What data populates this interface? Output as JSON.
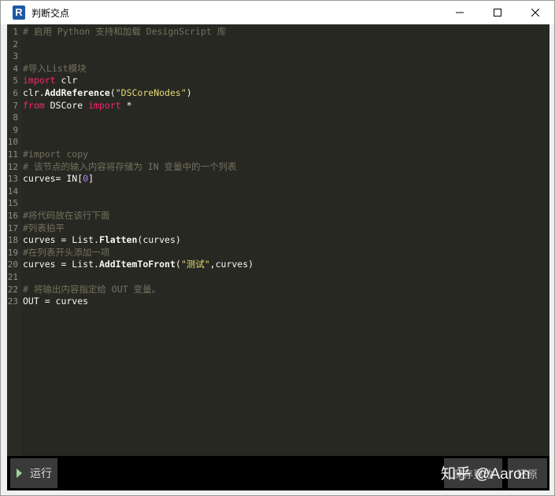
{
  "window": {
    "title": "判断交点",
    "icon_letter": "R",
    "controls": [
      "minimize-icon",
      "maximize-icon",
      "close-icon"
    ]
  },
  "editor": {
    "lines": [
      {
        "n": "1",
        "tokens": [
          {
            "t": "# 启用 Python 支持和加载 DesignScript 库",
            "c": "comment"
          }
        ]
      },
      {
        "n": "2",
        "tokens": []
      },
      {
        "n": "3",
        "tokens": []
      },
      {
        "n": "4",
        "tokens": [
          {
            "t": "#导入List模块",
            "c": "comment"
          }
        ]
      },
      {
        "n": "5",
        "tokens": [
          {
            "t": "import",
            "c": "kw"
          },
          {
            "t": " clr",
            "c": "plain"
          }
        ]
      },
      {
        "n": "6",
        "tokens": [
          {
            "t": "clr.",
            "c": "plain"
          },
          {
            "t": "AddReference",
            "c": "bold"
          },
          {
            "t": "(",
            "c": "plain"
          },
          {
            "t": "\"DSCoreNodes\"",
            "c": "str"
          },
          {
            "t": ")",
            "c": "plain"
          }
        ]
      },
      {
        "n": "7",
        "tokens": [
          {
            "t": "from",
            "c": "kw"
          },
          {
            "t": " DSCore ",
            "c": "plain"
          },
          {
            "t": "import",
            "c": "kw"
          },
          {
            "t": " *",
            "c": "plain"
          }
        ]
      },
      {
        "n": "8",
        "tokens": []
      },
      {
        "n": "9",
        "tokens": []
      },
      {
        "n": "10",
        "tokens": []
      },
      {
        "n": "11",
        "tokens": [
          {
            "t": "#import copy",
            "c": "comment"
          }
        ]
      },
      {
        "n": "12",
        "tokens": [
          {
            "t": "# 该节点的输入内容将存储为 IN 变量中的一个列表",
            "c": "comment"
          }
        ]
      },
      {
        "n": "13",
        "tokens": [
          {
            "t": "curves= IN[",
            "c": "plain"
          },
          {
            "t": "0",
            "c": "num"
          },
          {
            "t": "]",
            "c": "plain"
          }
        ]
      },
      {
        "n": "14",
        "tokens": []
      },
      {
        "n": "15",
        "tokens": []
      },
      {
        "n": "16",
        "tokens": [
          {
            "t": "#将代码放在该行下面",
            "c": "comment"
          }
        ]
      },
      {
        "n": "17",
        "tokens": [
          {
            "t": "#列表拍平",
            "c": "comment"
          }
        ]
      },
      {
        "n": "18",
        "tokens": [
          {
            "t": "curves = List.",
            "c": "plain"
          },
          {
            "t": "Flatten",
            "c": "bold"
          },
          {
            "t": "(curves)",
            "c": "plain"
          }
        ]
      },
      {
        "n": "19",
        "tokens": [
          {
            "t": "#在列表开头添加一项",
            "c": "comment"
          }
        ]
      },
      {
        "n": "20",
        "tokens": [
          {
            "t": "curves = List.",
            "c": "plain"
          },
          {
            "t": "AddItemToFront",
            "c": "bold"
          },
          {
            "t": "(",
            "c": "plain"
          },
          {
            "t": "\"测试\"",
            "c": "str"
          },
          {
            "t": ",curves)",
            "c": "plain"
          }
        ]
      },
      {
        "n": "21",
        "tokens": []
      },
      {
        "n": "22",
        "tokens": [
          {
            "t": "# 将输出内容指定给 OUT 变量。",
            "c": "comment"
          }
        ]
      },
      {
        "n": "23",
        "tokens": [
          {
            "t": "OUT = curves",
            "c": "plain"
          }
        ]
      }
    ]
  },
  "bottom": {
    "run_label": "运行",
    "save_label": "保存更改",
    "revert_label": "还原"
  },
  "watermark": "知乎 @Aaron",
  "colors": {
    "editor_bg": "#272822",
    "comment": "#75715e",
    "keyword": "#f92672",
    "string": "#e6db74",
    "number": "#ae81ff"
  }
}
